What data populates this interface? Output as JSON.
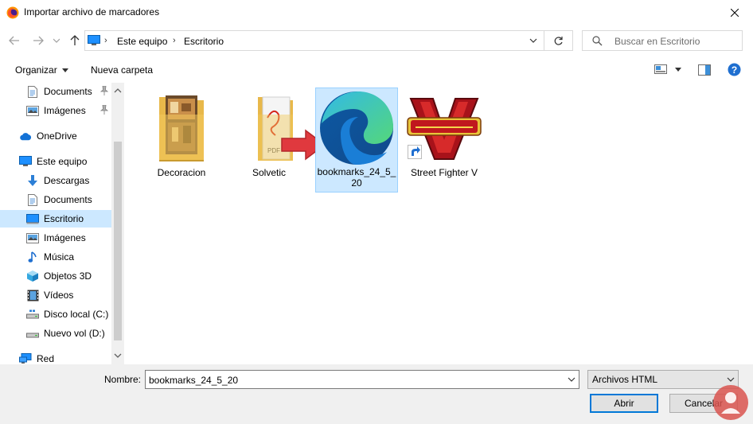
{
  "window": {
    "title": "Importar archivo de marcadores"
  },
  "nav": {
    "breadcrumbs": [
      "Este equipo",
      "Escritorio"
    ],
    "search_placeholder": "Buscar en Escritorio"
  },
  "toolbar": {
    "organize_label": "Organizar",
    "new_folder_label": "Nueva carpeta"
  },
  "sidebar": {
    "items": [
      {
        "label": "Documents",
        "icon": "document-icon",
        "pinned": true
      },
      {
        "label": "Imágenes",
        "icon": "pictures-icon",
        "pinned": true
      },
      {
        "label": "OneDrive",
        "icon": "cloud-icon"
      },
      {
        "label": "Este equipo",
        "icon": "computer-icon"
      },
      {
        "label": "Descargas",
        "icon": "download-icon"
      },
      {
        "label": "Documents",
        "icon": "document-icon"
      },
      {
        "label": "Escritorio",
        "icon": "desktop-icon",
        "selected": true
      },
      {
        "label": "Imágenes",
        "icon": "pictures-icon"
      },
      {
        "label": "Música",
        "icon": "music-icon"
      },
      {
        "label": "Objetos 3D",
        "icon": "cube-icon"
      },
      {
        "label": "Vídeos",
        "icon": "video-icon"
      },
      {
        "label": "Disco local (C:)",
        "icon": "drive-icon"
      },
      {
        "label": "Nuevo vol (D:)",
        "icon": "drive-icon"
      },
      {
        "label": "Red",
        "icon": "network-icon"
      }
    ]
  },
  "files": [
    {
      "name": "Decoracion",
      "icon": "folder-photos-icon"
    },
    {
      "name": "Solvetic",
      "icon": "folder-pdf-icon"
    },
    {
      "name": "bookmarks_24_5_20",
      "icon": "edge-icon",
      "selected": true
    },
    {
      "name": "Street Fighter V",
      "icon": "street-fighter-logo",
      "shortcut": true
    }
  ],
  "bottom": {
    "name_label": "Nombre:",
    "name_value": "bookmarks_24_5_20",
    "filetype_value": "Archivos HTML",
    "open_label": "Abrir",
    "cancel_label": "Cancelar"
  },
  "colors": {
    "selection": "#cce8ff",
    "accent": "#0078d7",
    "arrow": "#e0393e"
  }
}
